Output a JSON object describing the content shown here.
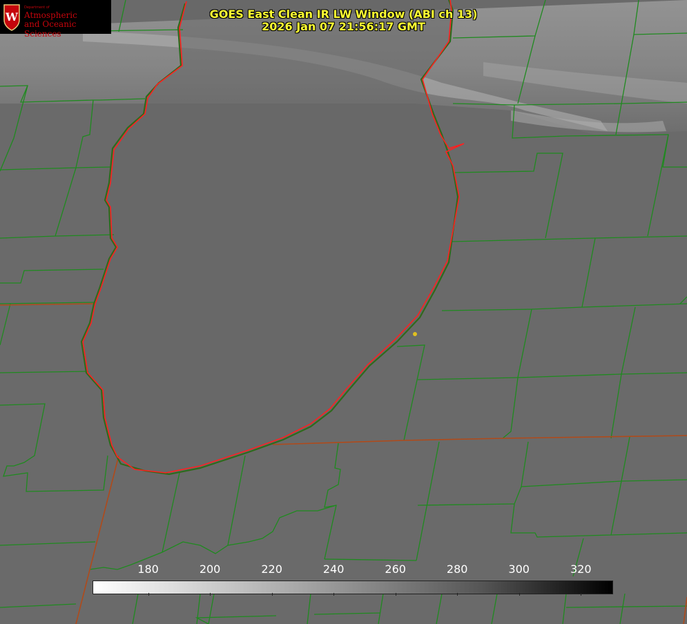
{
  "title": {
    "line1": "GOES East Clean IR LW Window (ABI ch 13)",
    "line2": "2026 Jan 07 21:56:17 GMT"
  },
  "logo": {
    "dept": "Department of",
    "line1": "Atmospheric",
    "line2": "and Oceanic Sciences",
    "crest_letter": "W"
  },
  "colorbar": {
    "min": 162,
    "max": 330,
    "ticks": [
      "180",
      "200",
      "220",
      "240",
      "260",
      "280",
      "300",
      "320"
    ]
  },
  "colors": {
    "title": "#ffff33",
    "county_lines": "#1f8a1f",
    "coastline": "#ff2020",
    "state_border": "#b04a1a",
    "marker": "#e0c020",
    "logo_red": "#c5050c"
  }
}
